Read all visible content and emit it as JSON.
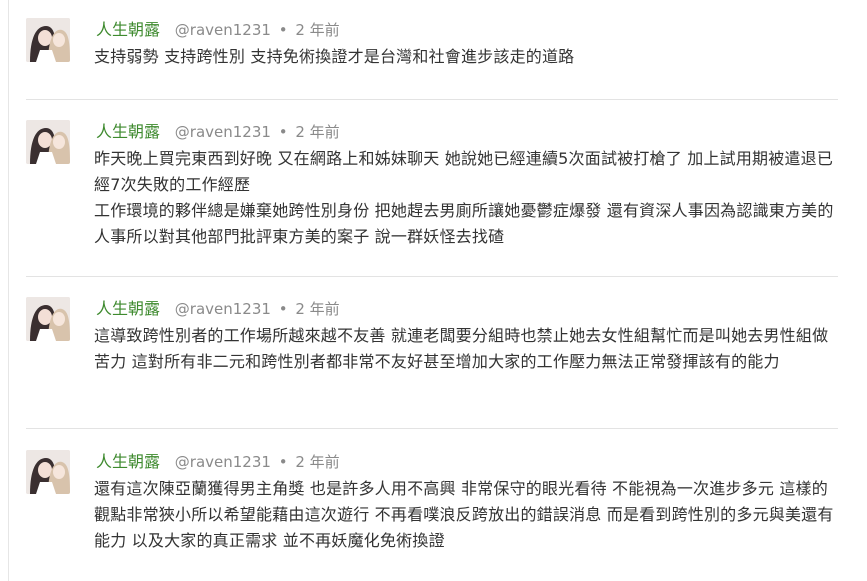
{
  "posts": [
    {
      "author": "人生朝露",
      "handle": "@raven1231",
      "separator": "•",
      "time": "2 年前",
      "paragraphs": [
        "支持弱勢 支持跨性別 支持免術換證才是台灣和社會進步該走的道路"
      ]
    },
    {
      "author": "人生朝露",
      "handle": "@raven1231",
      "separator": "•",
      "time": "2 年前",
      "paragraphs": [
        "昨天晚上買完東西到好晚 又在網路上和姊妹聊天 她說她已經連續5次面試被打槍了 加上試用期被遣退已經7次失敗的工作經歷",
        "工作環境的夥伴總是嫌棄她跨性別身份 把她趕去男廁所讓她憂鬱症爆發 還有資深人事因為認識東方美的人事所以對其他部門批評東方美的案子 說一群妖怪去找碴"
      ]
    },
    {
      "author": "人生朝露",
      "handle": "@raven1231",
      "separator": "•",
      "time": "2 年前",
      "paragraphs": [
        "這導致跨性別者的工作場所越來越不友善 就連老闆要分組時也禁止她去女性組幫忙而是叫她去男性組做苦力 這對所有非二元和跨性別者都非常不友好甚至增加大家的工作壓力無法正常發揮該有的能力"
      ]
    },
    {
      "author": "人生朝露",
      "handle": "@raven1231",
      "separator": "•",
      "time": "2 年前",
      "paragraphs": [
        "還有這次陳亞蘭獲得男主角獎 也是許多人用不高興 非常保守的眼光看待 不能視為一次進步多元 這樣的觀點非常狹小所以希望能藉由這次遊行 不再看噗浪反跨放出的錯誤消息 而是看到跨性別的多元與美還有能力 以及大家的真正需求 並不再妖魔化免術換證"
      ]
    }
  ]
}
